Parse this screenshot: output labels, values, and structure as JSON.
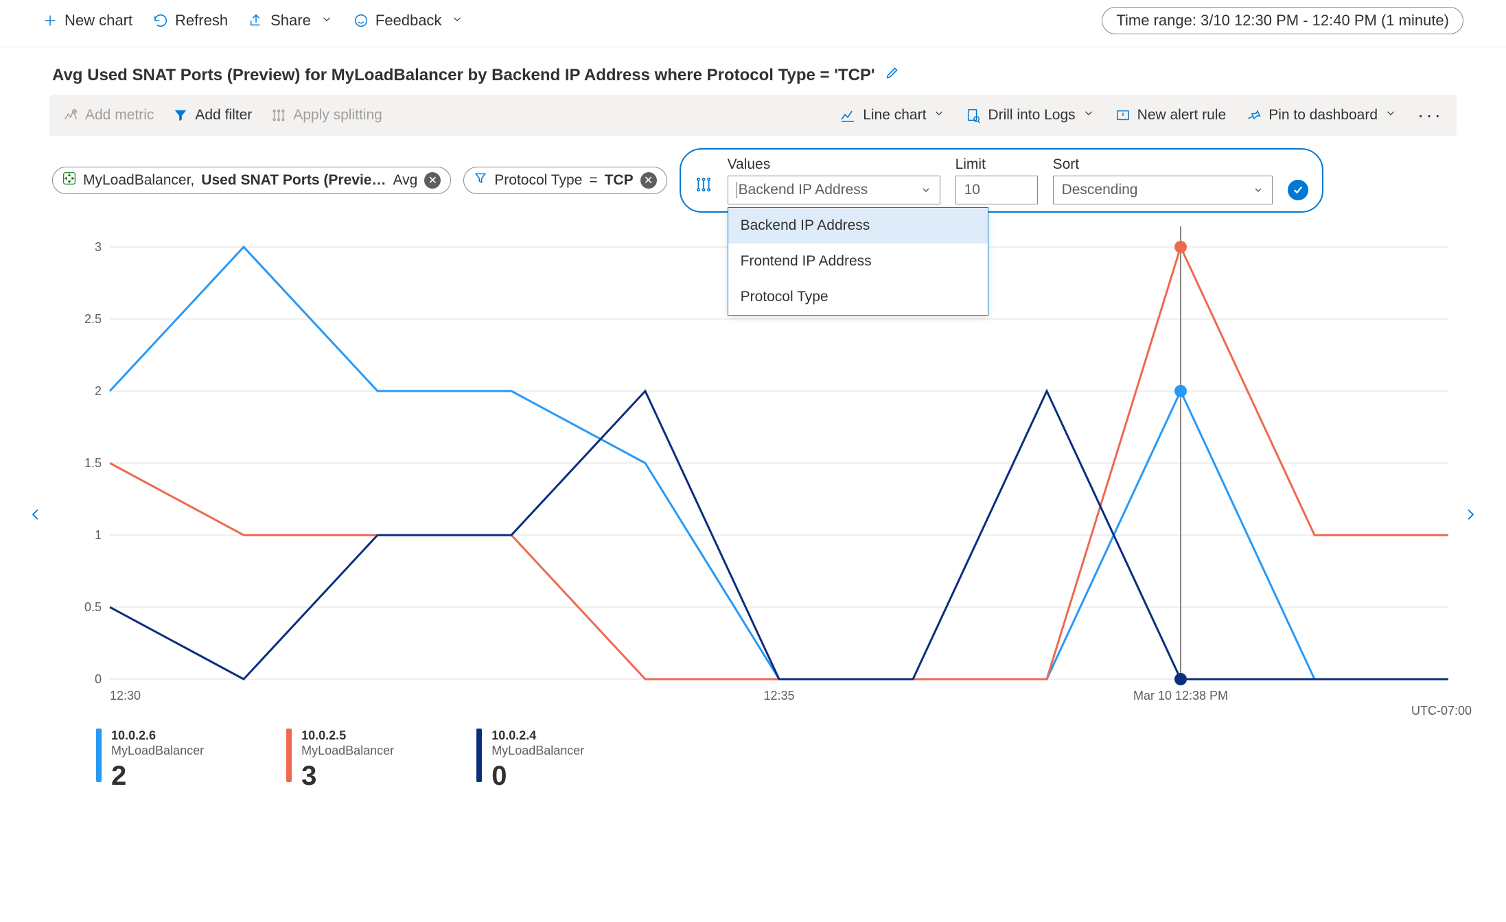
{
  "topbar": {
    "new_chart": "New chart",
    "refresh": "Refresh",
    "share": "Share",
    "feedback": "Feedback",
    "time_range": "Time range: 3/10 12:30 PM - 12:40 PM (1 minute)"
  },
  "title": "Avg Used SNAT Ports (Preview) for MyLoadBalancer by Backend IP Address where Protocol Type = 'TCP'",
  "toolbar": {
    "add_metric": "Add metric",
    "add_filter": "Add filter",
    "apply_splitting": "Apply splitting",
    "line_chart": "Line chart",
    "drill_logs": "Drill into Logs",
    "new_alert": "New alert rule",
    "pin_dash": "Pin to dashboard"
  },
  "pills": {
    "metric_pill_resource": "MyLoadBalancer,",
    "metric_pill_metric": "Used SNAT Ports (Previe…",
    "metric_pill_agg": "Avg",
    "filter_pill_key": "Protocol Type",
    "filter_pill_op": "=",
    "filter_pill_val": "TCP"
  },
  "split": {
    "values_label": "Values",
    "values_sel": "Backend IP Address",
    "limit_label": "Limit",
    "limit_val": "10",
    "sort_label": "Sort",
    "sort_sel": "Descending",
    "options": [
      "Backend IP Address",
      "Frontend IP Address",
      "Protocol Type"
    ]
  },
  "chart_data": {
    "type": "line",
    "ylim": [
      0,
      3
    ],
    "y_ticks": [
      0,
      0.5,
      1,
      1.5,
      2,
      2.5,
      3
    ],
    "x_ticks": [
      "12:30",
      "12:35"
    ],
    "x": [
      0,
      1,
      2,
      3,
      4,
      5,
      6,
      7,
      8,
      9,
      10
    ],
    "cursor_x": 8,
    "cursor_label": "Mar 10 12:38 PM",
    "tz": "UTC-07:00",
    "series": [
      {
        "name": "10.0.2.6",
        "resource": "MyLoadBalancer",
        "color": "#2899f5",
        "values": [
          2,
          3,
          2,
          2,
          1.5,
          0,
          0,
          0,
          2,
          0,
          0
        ],
        "cursor_val": 2
      },
      {
        "name": "10.0.2.5",
        "resource": "MyLoadBalancer",
        "color": "#ef6950",
        "values": [
          1.5,
          1,
          1,
          1,
          0,
          0,
          0,
          0,
          3,
          1,
          1
        ],
        "cursor_val": 3
      },
      {
        "name": "10.0.2.4",
        "resource": "MyLoadBalancer",
        "color": "#0b2e7f",
        "values": [
          0.5,
          0,
          1,
          1,
          2,
          0,
          0,
          2,
          0,
          0,
          0
        ],
        "cursor_val": 0
      }
    ]
  },
  "legend": [
    {
      "ip": "10.0.2.6",
      "resource": "MyLoadBalancer",
      "value": "2",
      "color": "#2899f5"
    },
    {
      "ip": "10.0.2.5",
      "resource": "MyLoadBalancer",
      "value": "3",
      "color": "#ef6950"
    },
    {
      "ip": "10.0.2.4",
      "resource": "MyLoadBalancer",
      "value": "0",
      "color": "#0b2e7f"
    }
  ]
}
